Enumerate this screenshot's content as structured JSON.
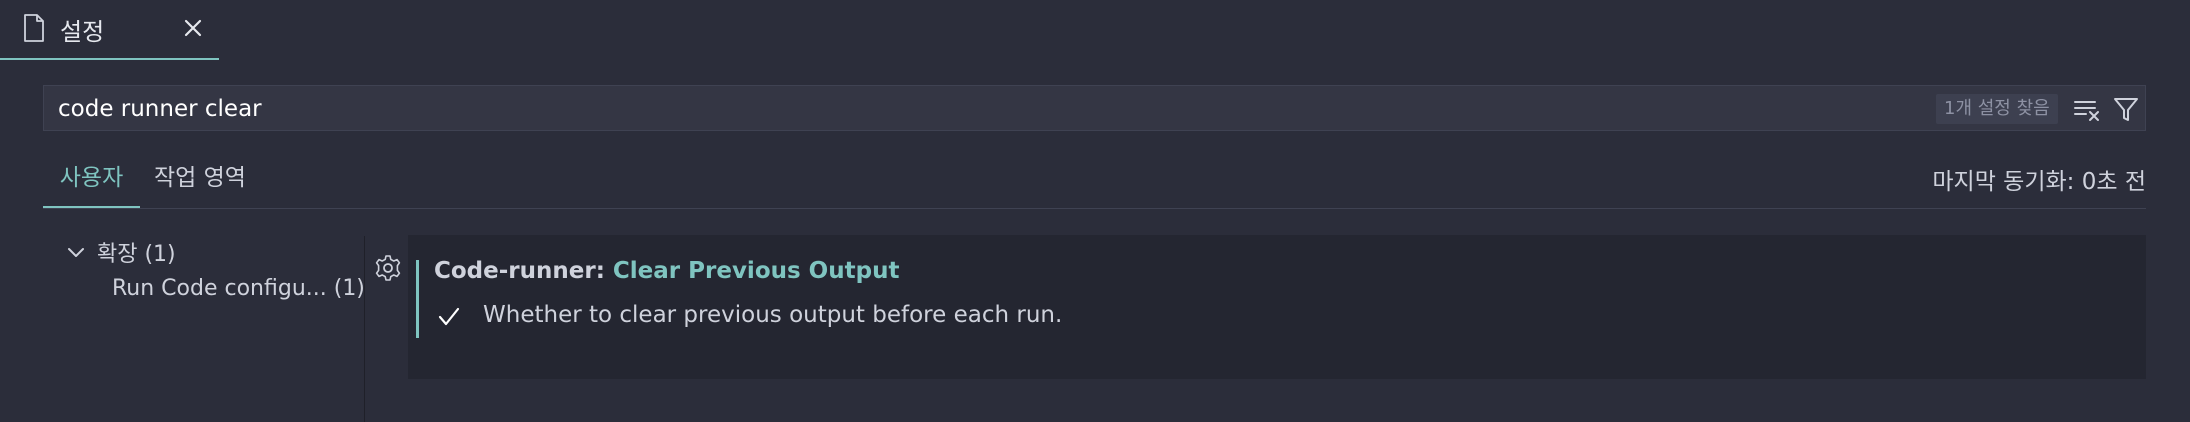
{
  "editor_tab": {
    "title": "설정",
    "icon": "file-icon",
    "close_icon": "close-icon"
  },
  "search": {
    "value": "code runner clear",
    "result_count": "1개 설정 찾음"
  },
  "scope_tabs": [
    {
      "label": "사용자",
      "active": true
    },
    {
      "label": "작업 영역",
      "active": false
    }
  ],
  "sync_status": "마지막 동기화: 0초 전",
  "toc": {
    "group_label": "확장 (1)",
    "items": [
      {
        "label": "Run Code configu... (1)"
      }
    ]
  },
  "setting": {
    "category": "Code-runner: ",
    "name": "Clear Previous Output",
    "description": "Whether to clear previous output before each run.",
    "checked": true
  },
  "colors": {
    "background": "#2b2d3a",
    "accent": "#7fc4c0",
    "card": "#242631",
    "text": "#cfd2dc"
  }
}
